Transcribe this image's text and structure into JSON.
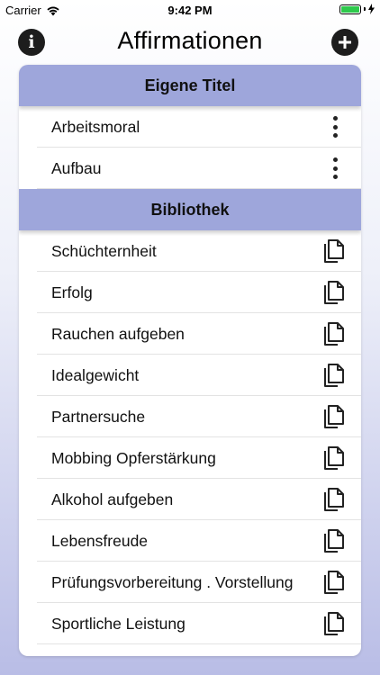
{
  "status_bar": {
    "carrier": "Carrier",
    "time": "9:42 PM"
  },
  "nav": {
    "title": "Affirmationen",
    "info_icon": "info-icon",
    "add_icon": "plus-circle-icon"
  },
  "colors": {
    "section_header": "#9ea6db",
    "background_bottom": "#b9bde6"
  },
  "sections": {
    "own": {
      "title": "Eigene Titel",
      "items": [
        {
          "label": "Arbeitsmoral",
          "icon": "more-vertical-icon"
        },
        {
          "label": "Aufbau",
          "icon": "more-vertical-icon"
        }
      ]
    },
    "library": {
      "title": "Bibliothek",
      "items": [
        {
          "label": "Schüchternheit",
          "icon": "copy-icon"
        },
        {
          "label": "Erfolg",
          "icon": "copy-icon"
        },
        {
          "label": "Rauchen aufgeben",
          "icon": "copy-icon"
        },
        {
          "label": "Idealgewicht",
          "icon": "copy-icon"
        },
        {
          "label": "Partnersuche",
          "icon": "copy-icon"
        },
        {
          "label": "Mobbing Opferstärkung",
          "icon": "copy-icon"
        },
        {
          "label": "Alkohol aufgeben",
          "icon": "copy-icon"
        },
        {
          "label": "Lebensfreude",
          "icon": "copy-icon"
        },
        {
          "label": "Prüfungsvorbereitung . Vorstellung",
          "icon": "copy-icon"
        },
        {
          "label": "Sportliche Leistung",
          "icon": "copy-icon"
        }
      ]
    }
  }
}
